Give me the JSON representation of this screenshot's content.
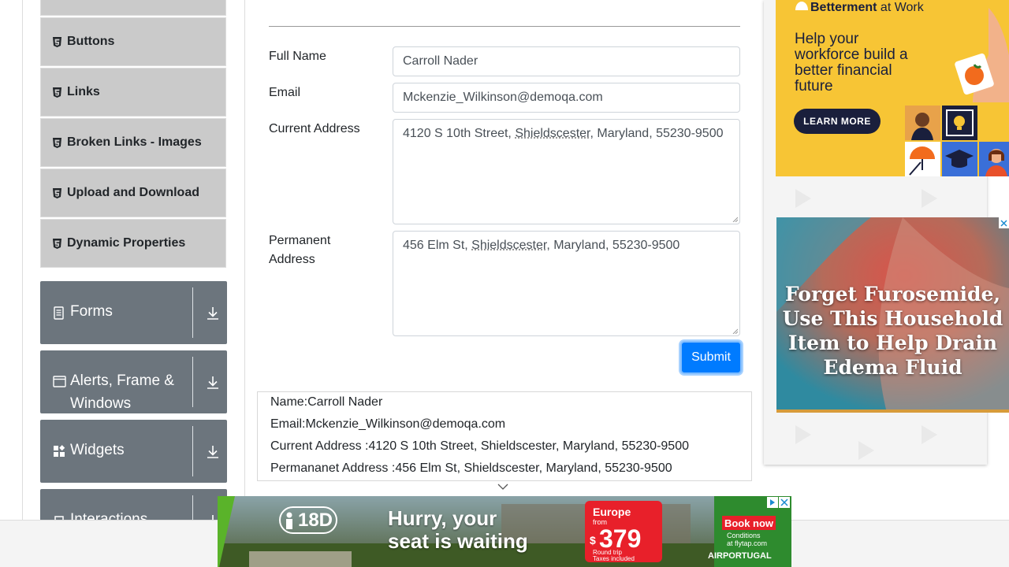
{
  "sidebar": {
    "sub_items": [
      {
        "label": "Buttons"
      },
      {
        "label": "Links"
      },
      {
        "label": "Broken Links - Images"
      },
      {
        "label": "Upload and Download"
      },
      {
        "label": "Dynamic Properties"
      }
    ],
    "groups": [
      {
        "label": "Forms",
        "icon": "document-icon"
      },
      {
        "label": "Alerts, Frame &",
        "label2": "Windows",
        "icon": "window-icon"
      },
      {
        "label": "Widgets",
        "icon": "widgets-icon"
      },
      {
        "label": "Interactions",
        "icon": "interactions-icon"
      }
    ]
  },
  "form": {
    "full_name": {
      "label": "Full Name",
      "value": "Carroll Nader"
    },
    "email": {
      "label": "Email",
      "value": "Mckenzie_Wilkinson@demoqa.com"
    },
    "current_address": {
      "label": "Current Address",
      "pre": "4120 S 10th Street, ",
      "city": "Shieldscester",
      "post": ", Maryland, 55230-9500"
    },
    "permanent_address": {
      "label_line1": "Permanent",
      "label_line2": "Address",
      "pre": "456 Elm St, ",
      "city": "Shieldscester",
      "post": ", Maryland, 55230-9500"
    },
    "submit_label": "Submit"
  },
  "output": {
    "name": "Name:Carroll Nader",
    "email": "Email:Mckenzie_Wilkinson@demoqa.com",
    "current": "Current Address :4120 S 10th Street, Shieldscester, Maryland, 55230-9500",
    "permanent": "Permananet Address :456 Elm St, Shieldscester, Maryland, 55230-9500"
  },
  "ads": {
    "betterment": {
      "brand_bold": "Betterment",
      "brand_rest": " at Work",
      "headline": "Help your workforce build a better financial future",
      "cta": "LEARN MORE",
      "color": "#f7c535"
    },
    "edema": {
      "text": "Forget Furosemide, Use This Household Item to Help Drain Edema Fluid"
    },
    "tap": {
      "age": "18D",
      "headline_1": "Hurry, your",
      "headline_2": "seat is waiting",
      "promo_top": "Europe",
      "promo_from": "from",
      "promo_currency": "$",
      "promo_price": "379",
      "promo_sub_1": "Round trip",
      "promo_sub_2": "Taxes included",
      "book": "Book now",
      "conditions_1": "Conditions",
      "conditions_2": "at flytap.com",
      "airline": "AIRPORTUGAL"
    }
  },
  "colors": {
    "sidebar_group": "#6c757d",
    "sidebar_item": "#cacaca",
    "submit": "#007bff"
  }
}
